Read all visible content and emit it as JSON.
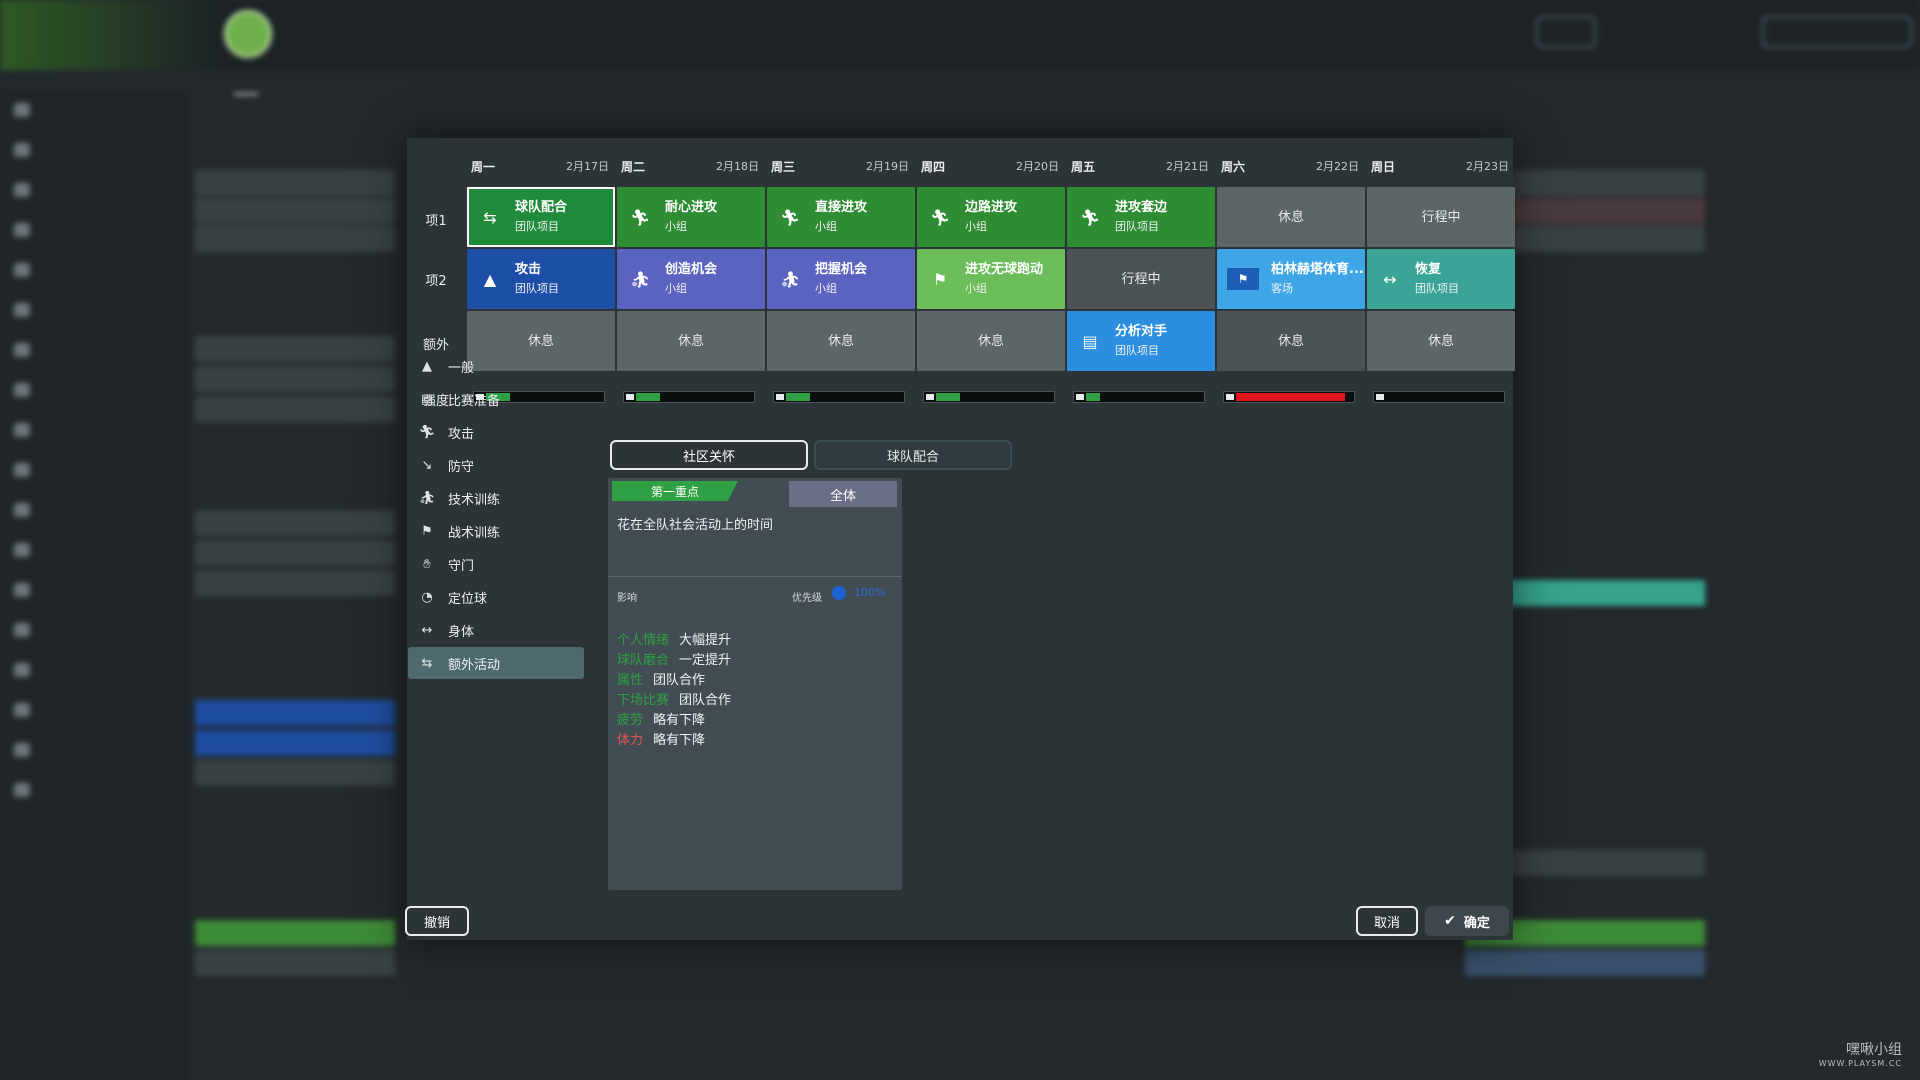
{
  "header": {
    "title": "",
    "subtitle": ""
  },
  "week": [
    {
      "day": "周一",
      "date": "2月17日"
    },
    {
      "day": "周二",
      "date": "2月18日"
    },
    {
      "day": "周三",
      "date": "2月19日"
    },
    {
      "day": "周四",
      "date": "2月20日"
    },
    {
      "day": "周五",
      "date": "2月21日"
    },
    {
      "day": "周六",
      "date": "2月22日"
    },
    {
      "day": "周日",
      "date": "2月23日"
    }
  ],
  "row_labels": {
    "slot1": "项1",
    "slot2": "项2",
    "extra": "额外",
    "intensity": "强度"
  },
  "slot1": [
    {
      "name": "球队配合",
      "type": "团队项目",
      "icon": "team-play-icon",
      "color": "#1f8b3b"
    },
    {
      "name": "耐心进攻",
      "type": "小组",
      "icon": "attack-runner-icon",
      "color": "#2e8d33"
    },
    {
      "name": "直接进攻",
      "type": "小组",
      "icon": "attack-runner-icon",
      "color": "#2e8d33"
    },
    {
      "name": "边路进攻",
      "type": "小组",
      "icon": "attack-runner-icon",
      "color": "#2e8d33"
    },
    {
      "name": "进攻套边",
      "type": "团队项目",
      "icon": "attack-runner-icon",
      "color": "#2e8d33"
    },
    {
      "name": "休息",
      "type": "",
      "icon": "",
      "color": "#5d6569"
    },
    {
      "name": "行程中",
      "type": "",
      "icon": "",
      "color": "#5d6569"
    }
  ],
  "slot2": [
    {
      "name": "攻击",
      "type": "团队项目",
      "icon": "general-icon",
      "color": "#1d4fa8"
    },
    {
      "name": "创造机会",
      "type": "小组",
      "icon": "technique-icon",
      "color": "#5a63bf"
    },
    {
      "name": "把握机会",
      "type": "小组",
      "icon": "technique-icon",
      "color": "#5a63bf"
    },
    {
      "name": "进攻无球跑动",
      "type": "小组",
      "icon": "tactics-icon",
      "color": "#6bbd5a"
    },
    {
      "name": "行程中",
      "type": "",
      "icon": "",
      "color": "#4b5357"
    },
    {
      "name": "柏林赫塔体育...",
      "type": "客场",
      "icon": "club-flag-icon",
      "color": "#3ea6e6"
    },
    {
      "name": "恢复",
      "type": "团队项目",
      "icon": "physical-icon",
      "color": "#3aa597"
    }
  ],
  "extra": [
    {
      "name": "休息",
      "type": "",
      "icon": "",
      "color": "#5d6569"
    },
    {
      "name": "休息",
      "type": "",
      "icon": "",
      "color": "#5d6569"
    },
    {
      "name": "休息",
      "type": "",
      "icon": "",
      "color": "#5d6569"
    },
    {
      "name": "休息",
      "type": "",
      "icon": "",
      "color": "#5d6569"
    },
    {
      "name": "分析对手",
      "type": "团队项目",
      "icon": "match-prep-icon",
      "color": "#2b8ee0"
    },
    {
      "name": "休息",
      "type": "",
      "icon": "",
      "color": "#4b5357"
    },
    {
      "name": "休息",
      "type": "",
      "icon": "",
      "color": "#5d6569"
    }
  ],
  "intensity": [
    {
      "level": 0.2,
      "color": "#2ea043"
    },
    {
      "level": 0.2,
      "color": "#2ea043"
    },
    {
      "level": 0.2,
      "color": "#2ea043"
    },
    {
      "level": 0.2,
      "color": "#2ea043"
    },
    {
      "level": 0.12,
      "color": "#2ea043"
    },
    {
      "level": 0.92,
      "color": "#e0151b"
    },
    {
      "level": 0.0,
      "color": "#2ea043"
    }
  ],
  "categories": [
    {
      "label": "一般",
      "icon": "general-icon",
      "active": false
    },
    {
      "label": "比赛准备",
      "icon": "match-prep-icon",
      "active": false
    },
    {
      "label": "攻击",
      "icon": "attack-icon",
      "active": false
    },
    {
      "label": "防守",
      "icon": "defence-icon",
      "active": false
    },
    {
      "label": "技术训练",
      "icon": "technique-icon",
      "active": false
    },
    {
      "label": "战术训练",
      "icon": "tactics-icon",
      "active": false
    },
    {
      "label": "守门",
      "icon": "goalkeeping-icon",
      "active": false
    },
    {
      "label": "定位球",
      "icon": "set-piece-icon",
      "active": false
    },
    {
      "label": "身体",
      "icon": "physical-icon",
      "active": false
    },
    {
      "label": "额外活动",
      "icon": "extra-activity-icon",
      "active": true
    }
  ],
  "tabs": {
    "community": "社区关怀",
    "teamplay": "球队配合"
  },
  "detail": {
    "focus": "第一重点",
    "scope": "全体",
    "description": "花在全队社会活动上的时间",
    "impact_label": "影响",
    "priority_label": "优先级",
    "priority_value": "100%",
    "effects": [
      {
        "key": "个人情绪",
        "value": "大幅提升",
        "color": "#2ea043"
      },
      {
        "key": "球队磨合",
        "value": "一定提升",
        "color": "#2ea043"
      },
      {
        "key": "属性",
        "value": "团队合作",
        "color": "#2ea043"
      },
      {
        "key": "下场比赛",
        "value": "团队合作",
        "color": "#2ea043"
      },
      {
        "key": "疲劳",
        "value": "略有下降",
        "color": "#2ea043"
      },
      {
        "key": "体力",
        "value": "略有下降",
        "color": "#e05656"
      }
    ]
  },
  "buttons": {
    "undo": "撤销",
    "cancel": "取消",
    "ok": "确定"
  },
  "watermark": {
    "title": "嘿啾小组",
    "site": "WWW.PLAYSM.CC"
  }
}
